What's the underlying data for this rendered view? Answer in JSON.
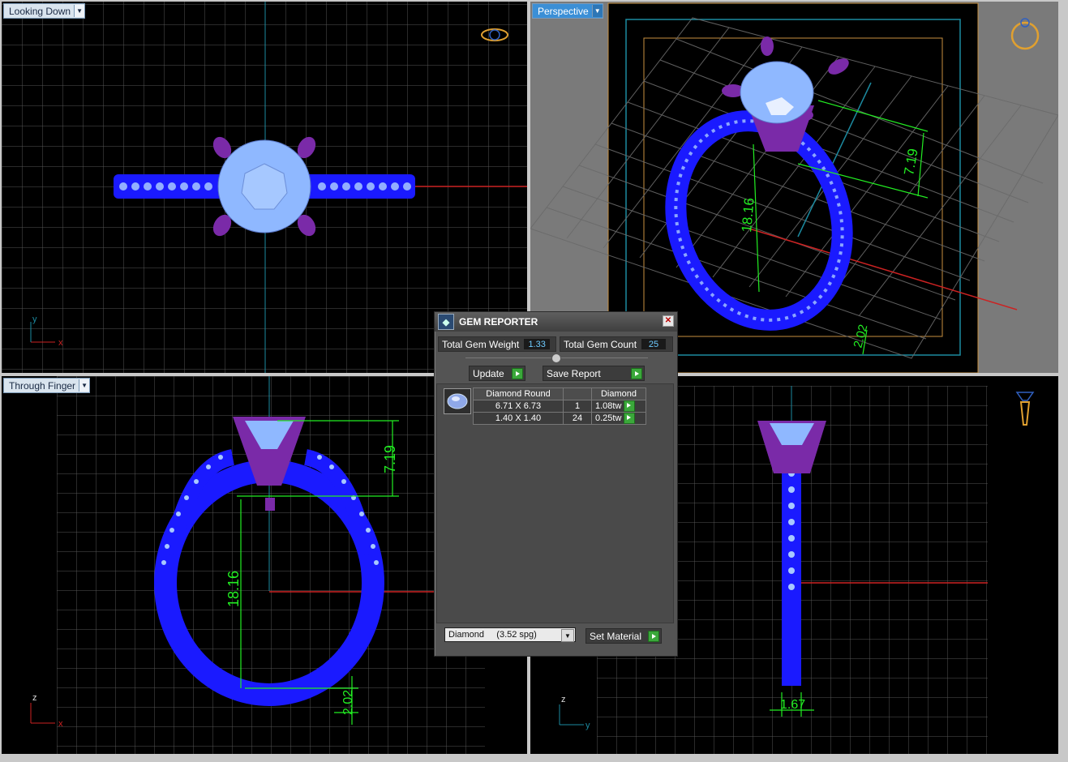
{
  "viewports": {
    "top_left": {
      "label": "Looking Down",
      "axis_a": "y",
      "axis_b": "x"
    },
    "top_right": {
      "label": "Perspective"
    },
    "bottom_left": {
      "label": "Through Finger",
      "axis_a": "z",
      "axis_b": "x"
    },
    "bottom_right": {
      "label": "",
      "axis_a": "z",
      "axis_b": "y"
    }
  },
  "dimensions": {
    "persp_height": "7.19",
    "persp_inner": "18.16",
    "persp_band": "2.02",
    "front_height": "7.19",
    "front_inner": "18.16",
    "front_band": "2.02",
    "side_width": "1.67"
  },
  "gem_reporter": {
    "title": "GEM REPORTER",
    "close": "✕",
    "total_weight_label": "Total Gem Weight",
    "total_weight_value": "1.33",
    "total_count_label": "Total Gem Count",
    "total_count_value": "25",
    "update_label": "Update",
    "save_report_label": "Save Report",
    "columns": [
      "Diamond Round",
      "",
      "Diamond"
    ],
    "rows": [
      {
        "size": "6.71 X 6.73",
        "count": "1",
        "weight": "1.08tw"
      },
      {
        "size": "1.40 X 1.40",
        "count": "24",
        "weight": "0.25tw"
      }
    ],
    "material_select": "Diamond     (3.52 spg)",
    "set_material_label": "Set Material"
  },
  "colors": {
    "metal": "#1a1aff",
    "prongs": "#7a2aa8",
    "gem": "#8fb8ff",
    "grid": "#555555",
    "dimension": "#22ee22",
    "axis_red": "#cc2222",
    "axis_cyan": "#1c8aa0"
  }
}
